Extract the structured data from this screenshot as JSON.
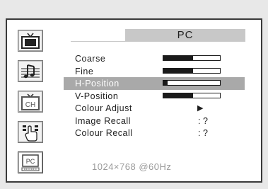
{
  "header": {
    "title": "PC"
  },
  "sidebar": {
    "items": [
      {
        "icon": "picture-icon"
      },
      {
        "icon": "sound-icon"
      },
      {
        "icon": "channel-icon",
        "label": "CH"
      },
      {
        "icon": "setup-icon"
      },
      {
        "icon": "pc-icon",
        "label": "PC",
        "selected": true
      }
    ]
  },
  "menu": {
    "items": [
      {
        "label": "Coarse",
        "type": "bar",
        "level": 0.52
      },
      {
        "label": "Fine",
        "type": "bar",
        "level": 0.52
      },
      {
        "label": "H-Position",
        "type": "bar",
        "level": 0.07,
        "highlighted": true
      },
      {
        "label": "V-Position",
        "type": "bar",
        "level": 0.52
      },
      {
        "label": "Colour Adjust",
        "type": "arrow",
        "value": "▶"
      },
      {
        "label": "Image Recall",
        "type": "text",
        "value": ": ?"
      },
      {
        "label": "Colour Recall",
        "type": "text",
        "value": ": ?"
      }
    ]
  },
  "status": {
    "resolution": "1024×768 @60Hz"
  },
  "colors": {
    "highlight": "#a9a9a9",
    "header": "#c8c8c8",
    "frame": "#3a3a3a"
  }
}
